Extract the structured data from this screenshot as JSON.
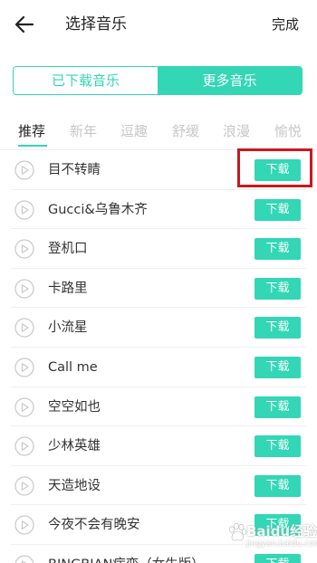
{
  "header": {
    "title": "选择音乐",
    "done_label": "完成"
  },
  "segment": {
    "items": [
      {
        "label": "已下载音乐",
        "active": false
      },
      {
        "label": "更多音乐",
        "active": true
      }
    ]
  },
  "tabs": [
    {
      "label": "推荐",
      "active": true
    },
    {
      "label": "新年",
      "active": false
    },
    {
      "label": "逗趣",
      "active": false
    },
    {
      "label": "舒缓",
      "active": false
    },
    {
      "label": "浪漫",
      "active": false
    },
    {
      "label": "愉悦",
      "active": false
    }
  ],
  "songs": [
    {
      "name": "目不转睛",
      "action": "下载"
    },
    {
      "name": "Gucci&乌鲁木齐",
      "action": "下载"
    },
    {
      "name": "登机口",
      "action": "下载"
    },
    {
      "name": "卡路里",
      "action": "下载"
    },
    {
      "name": "小流星",
      "action": "下载"
    },
    {
      "name": "Call me",
      "action": "下载"
    },
    {
      "name": "空空如也",
      "action": "下载"
    },
    {
      "name": "少林英雄",
      "action": "下载"
    },
    {
      "name": "天造地设",
      "action": "下载"
    },
    {
      "name": "今夜不会有晚安",
      "action": "下载"
    },
    {
      "name": "BINGBIAN病变（女生版）",
      "action": "下载"
    }
  ],
  "watermark": {
    "text": "Baidu经验",
    "sub": "jingyan.baidu.com"
  },
  "colors": {
    "accent": "#33d6b5",
    "highlight": "#c8191f"
  },
  "icons": {
    "back": "arrow-left-icon",
    "play": "play-circle-icon"
  }
}
